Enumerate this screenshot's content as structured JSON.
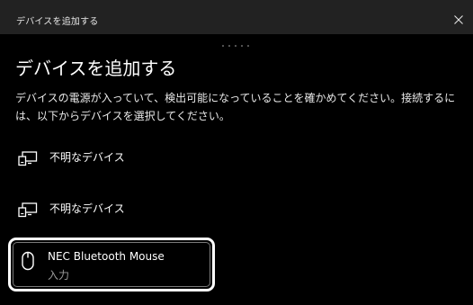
{
  "window": {
    "title": "デバイスを追加する",
    "close_icon": "close-icon"
  },
  "main": {
    "heading": "デバイスを追加する",
    "description": "デバイスの電源が入っていて、検出可能になっていることを確かめてください。接続するには、以下からデバイスを選択してください。"
  },
  "devices": [
    {
      "name": "不明なデバイス",
      "icon": "unknown-device-icon"
    },
    {
      "name": "不明なデバイス",
      "icon": "unknown-device-icon"
    },
    {
      "name": "NEC Bluetooth Mouse",
      "type": "入力",
      "icon": "mouse-icon",
      "selected": true
    }
  ],
  "colors": {
    "background": "#000000",
    "titlebar": "#222222",
    "text": "#ffffff",
    "secondary_text": "#9a9a9a",
    "focus_border": "#ffffff"
  }
}
